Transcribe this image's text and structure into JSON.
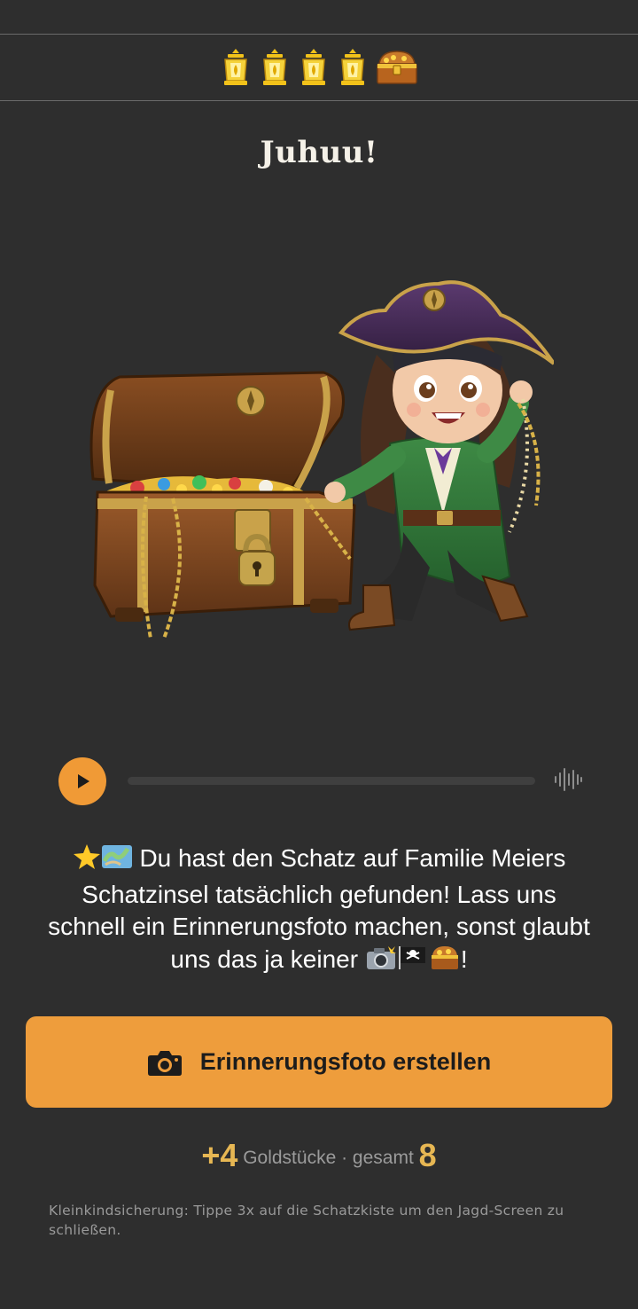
{
  "progress": {
    "lanterns_found": 4,
    "icons": [
      "lantern-icon",
      "lantern-icon",
      "lantern-icon",
      "lantern-icon",
      "treasure-chest-icon"
    ]
  },
  "title": "Juhuu!",
  "illustration": {
    "subject": "pirate-girl-with-treasure-chest"
  },
  "audio": {
    "progress": 0,
    "play_icon": "play-icon",
    "wave_icon": "waveform-icon"
  },
  "message": {
    "lead_emojis": [
      "star-emoji",
      "map-emoji"
    ],
    "text": "Du hast den Schatz auf Familie Meiers Schatzinsel tatsächlich gefunden! Lass uns schnell ein Erinnerungsfoto machen, sonst glaubt uns das ja keiner",
    "trail_emojis": [
      "camera-flash-emoji",
      "pirate-flag-emoji",
      "treasure-chest-emoji"
    ],
    "end": "!"
  },
  "cta": {
    "label": "Erinnerungsfoto erstellen",
    "icon": "camera-icon"
  },
  "score": {
    "gained": "+4",
    "label": "Goldstücke · gesamt",
    "total": "8"
  },
  "hint": "Kleinkindsicherung: Tippe 3x auf die Schatzkiste um den Jagd-Screen zu schließen.",
  "colors": {
    "background": "#2e2e2e",
    "accent": "#ee9d3c",
    "gold": "#e7b753"
  }
}
